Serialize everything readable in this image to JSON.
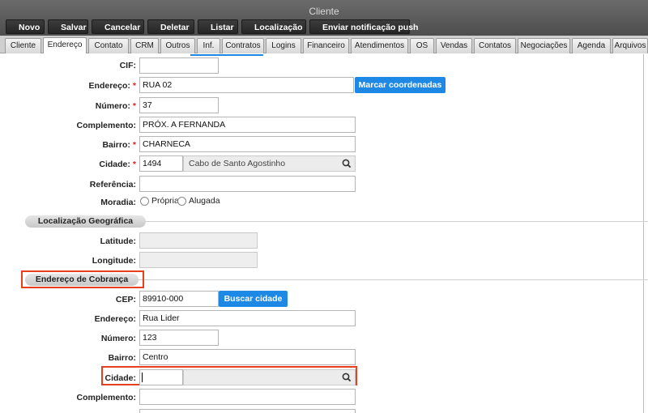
{
  "window": {
    "title": "Cliente"
  },
  "toolbar": {
    "novo": "Novo",
    "salvar": "Salvar",
    "cancelar": "Cancelar",
    "deletar": "Deletar",
    "listar": "Listar",
    "localizacao": "Localização",
    "push": "Enviar notificação push"
  },
  "tabs": [
    "Cliente",
    "Endereço",
    "Contato",
    "CRM",
    "Outros",
    "Inf.",
    "Contratos",
    "Logins",
    "Financeiro",
    "Atendimentos",
    "OS",
    "Vendas",
    "Contatos",
    "Negociações",
    "Agenda",
    "Arquivos"
  ],
  "endereco": {
    "cif_label": "CIF:",
    "cif_value": "",
    "endereco_label": "Endereço:",
    "endereco_value": "RUA 02",
    "marcar_button": "Marcar coordenadas",
    "numero_label": "Número:",
    "numero_value": "37",
    "complemento_label": "Complemento:",
    "complemento_value": "PRÓX. A FERNANDA",
    "bairro_label": "Bairro:",
    "bairro_value": "CHARNECA",
    "cidade_label": "Cidade:",
    "cidade_code": "1494",
    "cidade_name": "Cabo de Santo Agostinho",
    "referencia_label": "Referência:",
    "referencia_value": "",
    "moradia_label": "Moradia:",
    "moradia_propria": "Própria",
    "moradia_alugada": "Alugada"
  },
  "geo": {
    "section_title": "Localização Geográfica",
    "latitude_label": "Latitude:",
    "latitude_value": "",
    "longitude_label": "Longitude:",
    "longitude_value": ""
  },
  "cobranca": {
    "section_title": "Endereço de Cobrança",
    "cep_label": "CEP:",
    "cep_value": "89910-000",
    "buscar_button": "Buscar cidade",
    "endereco_label": "Endereço:",
    "endereco_value": "Rua Lider",
    "numero_label": "Número:",
    "numero_value": "123",
    "bairro_label": "Bairro:",
    "bairro_value": "Centro",
    "cidade_label": "Cidade:",
    "cidade_value": "",
    "complemento_label": "Complemento:",
    "complemento_value": ""
  },
  "colors": {
    "accent": "#1e88e5",
    "highlight": "#e8401c",
    "required": "#dd2222"
  },
  "icons": {
    "search": "search-icon"
  }
}
